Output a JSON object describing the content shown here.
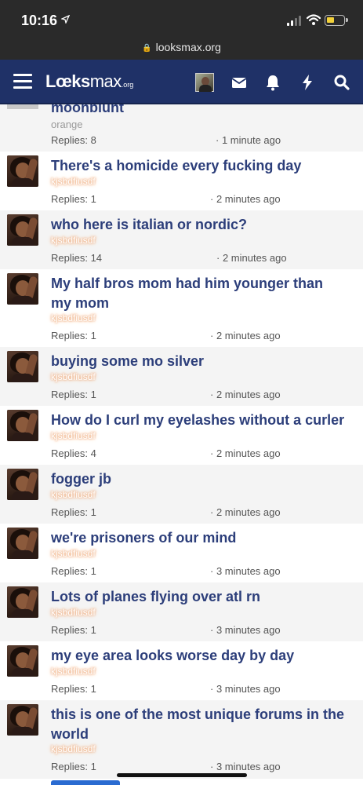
{
  "status_bar": {
    "time": "10:16",
    "location_icon": "location-arrow-icon",
    "signal_icon": "cellular-signal-icon",
    "wifi_icon": "wifi-icon",
    "battery_icon": "battery-icon",
    "battery_color": "#f2d13a"
  },
  "url_bar": {
    "lock_icon": "lock-icon",
    "url": "looksmax.org"
  },
  "navbar": {
    "background": "#1f3167",
    "logo_main": "Lœks",
    "logo_max": "max",
    "logo_org": ".org",
    "icons": [
      "menu-icon",
      "user-avatar",
      "mail-icon",
      "bell-icon",
      "lightning-icon",
      "search-icon"
    ]
  },
  "threads": [
    {
      "title": "moonblunt",
      "author": "orange",
      "replies": "Replies: 8",
      "time": "· 1 minute ago"
    },
    {
      "title": "There's a homicide every fucking day",
      "author": "kjsbdfiusdf",
      "replies": "Replies: 1",
      "time": "· 2 minutes ago"
    },
    {
      "title": "who here is italian or nordic?",
      "author": "kjsbdfiusdf",
      "replies": "Replies: 14",
      "time": "· 2 minutes ago"
    },
    {
      "title": "My half bros mom had him younger than my mom",
      "author": "kjsbdfiusdf",
      "replies": "Replies: 1",
      "time": "· 2 minutes ago"
    },
    {
      "title": "buying some mo silver",
      "author": "kjsbdfiusdf",
      "replies": "Replies: 1",
      "time": "· 2 minutes ago"
    },
    {
      "title": "How do I curl my eyelashes without a curler",
      "author": "kjsbdfiusdf",
      "replies": "Replies: 4",
      "time": "· 2 minutes ago"
    },
    {
      "title": "fogger jb",
      "author": "kjsbdfiusdf",
      "replies": "Replies: 1",
      "time": "· 2 minutes ago"
    },
    {
      "title": "we're prisoners of our mind",
      "author": "kjsbdfiusdf",
      "replies": "Replies: 1",
      "time": "· 3 minutes ago"
    },
    {
      "title": "Lots of planes flying over atl rn",
      "author": "kjsbdfiusdf",
      "replies": "Replies: 1",
      "time": "· 3 minutes ago"
    },
    {
      "title": "my eye area looks worse day by day",
      "author": "kjsbdfiusdf",
      "replies": "Replies: 1",
      "time": "· 3 minutes ago"
    },
    {
      "title": "this is one of the most unique forums in the world",
      "author": "kjsbdfiusdf",
      "replies": "Replies: 1",
      "time": "· 3 minutes ago"
    }
  ]
}
